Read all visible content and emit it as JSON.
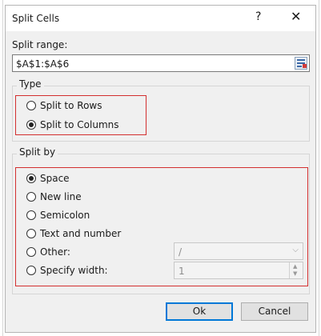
{
  "dialog": {
    "title": "Split Cells",
    "help_glyph": "?",
    "close_glyph": "✕"
  },
  "split_range": {
    "label": "Split range:",
    "value": "$A$1:$A$6"
  },
  "type_group": {
    "title": "Type",
    "options": [
      {
        "label": "Split to Rows",
        "checked": false
      },
      {
        "label": "Split to Columns",
        "checked": true
      }
    ]
  },
  "split_by": {
    "title": "Split by",
    "options": [
      {
        "label": "Space",
        "checked": true
      },
      {
        "label": "New line",
        "checked": false
      },
      {
        "label": "Semicolon",
        "checked": false
      },
      {
        "label": "Text and number",
        "checked": false
      },
      {
        "label": "Other:",
        "checked": false
      },
      {
        "label": "Specify width:",
        "checked": false
      }
    ],
    "other_value": "/",
    "width_value": "1"
  },
  "buttons": {
    "ok": "Ok",
    "cancel": "Cancel"
  },
  "colors": {
    "highlight": "#d32f2f",
    "default_button_border": "#0078d7"
  }
}
